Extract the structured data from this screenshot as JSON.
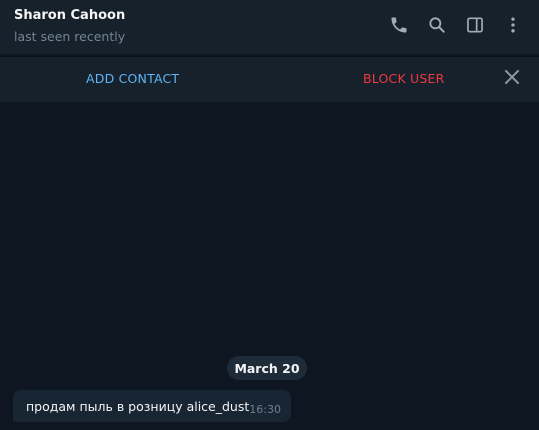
{
  "header": {
    "contact_name": "Sharon Cahoon",
    "status": "last seen recently",
    "icons": [
      "phone-icon",
      "search-icon",
      "sidebar-toggle-icon",
      "more-vertical-icon"
    ]
  },
  "action_bar": {
    "add_contact_label": "ADD CONTACT",
    "block_user_label": "BLOCK USER",
    "close_icon": "close-icon"
  },
  "chat": {
    "date_separator": "March 20",
    "messages": [
      {
        "text": "продам пыль в розницу alice_dust",
        "time": "16:30",
        "direction": "incoming"
      }
    ]
  },
  "colors": {
    "background": "#0e1621",
    "header_bg": "#17212b",
    "accent_blue": "#5eb5f7",
    "danger_red": "#ec3942",
    "bubble_bg": "#182533",
    "muted_text": "#708499"
  }
}
